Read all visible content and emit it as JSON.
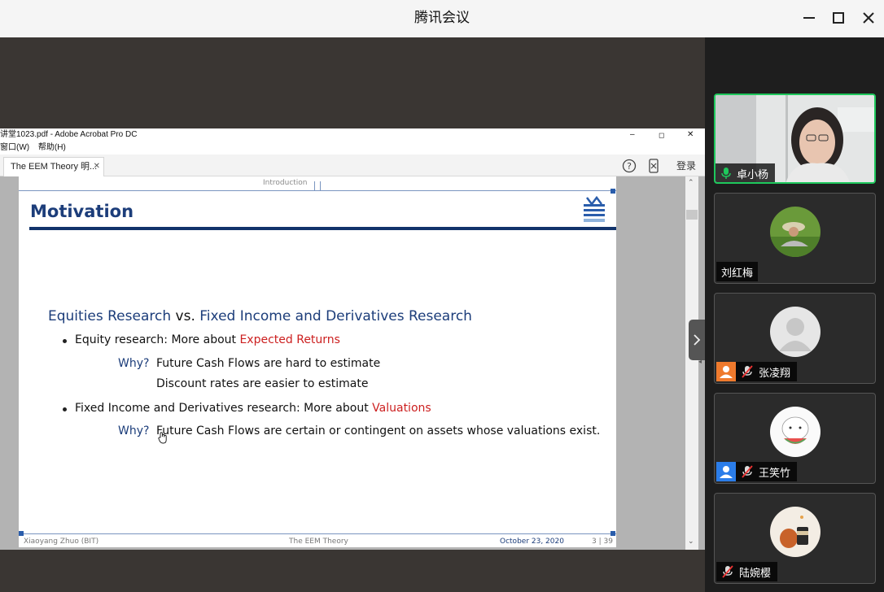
{
  "window": {
    "title": "腾讯会议"
  },
  "acrobat": {
    "title": "讲堂1023.pdf - Adobe Acrobat Pro DC",
    "menu": [
      "窗口(W)",
      "帮助(H)"
    ],
    "tab_label": "The EEM Theory 明...",
    "login_label": "登录"
  },
  "slide": {
    "section": "Introduction",
    "title": "Motivation",
    "heading_part1": "Equities Research",
    "heading_vs": "vs.",
    "heading_part2": "Fixed Income and Derivatives Research",
    "bullet1_text": "Equity research: More about ",
    "bullet1_highlight": "Expected Returns",
    "why_label": "Why?",
    "why1_line1": "Future Cash Flows are hard to estimate",
    "why1_line2": "Discount rates are easier to estimate",
    "bullet2_text": "Fixed Income and Derivatives research: More about ",
    "bullet2_highlight": "Valuations",
    "why2_line1": "Future Cash Flows are certain or contingent on assets whose valuations exist.",
    "footer_author": "Xiaoyang Zhuo  (BIT)",
    "footer_title": "The EEM Theory",
    "footer_date": "October 23, 2020",
    "footer_page": "3 | 39"
  },
  "participants": [
    {
      "name": "卓小杨",
      "mic": "on",
      "has_video": true
    },
    {
      "name": "刘红梅",
      "mic": "none",
      "has_video": false
    },
    {
      "name": "张凌翔",
      "mic": "muted",
      "has_video": false
    },
    {
      "name": "王笑竹",
      "mic": "muted",
      "has_video": false
    },
    {
      "name": "陆婉樱",
      "mic": "muted",
      "has_video": false
    }
  ],
  "colors": {
    "accent_green": "#1ec85c",
    "slide_blue": "#1c3d7a",
    "slide_red": "#cc1f1f"
  }
}
